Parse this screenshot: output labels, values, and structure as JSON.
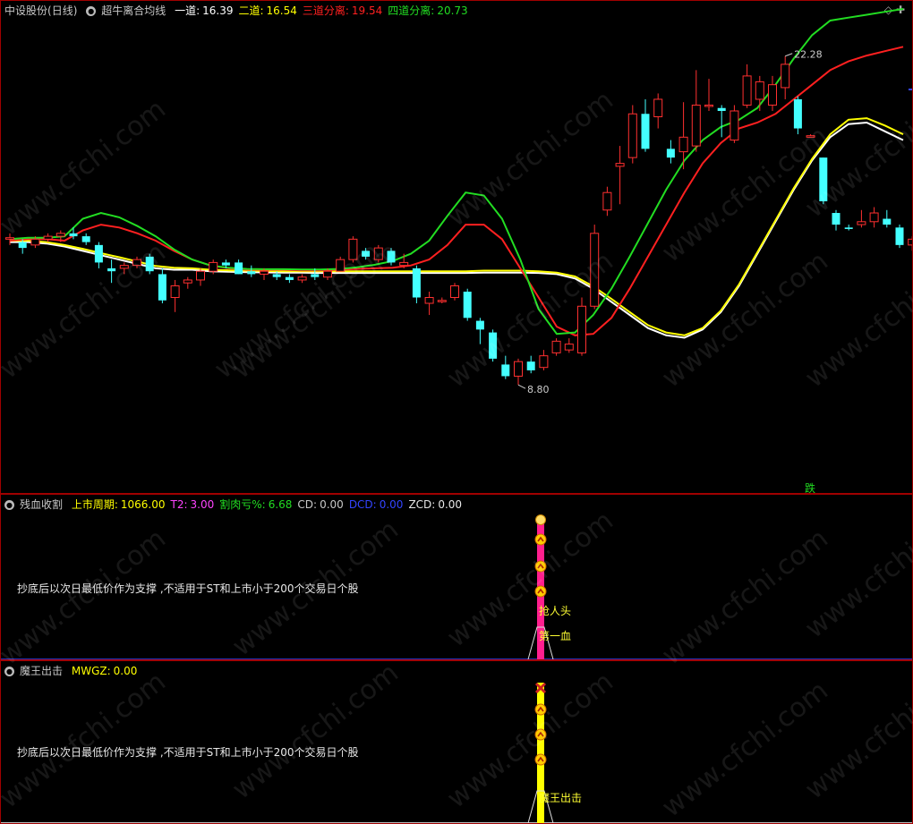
{
  "main": {
    "stock_name": "中设股份",
    "period": "(日线)",
    "indicator_name": "超牛离合均线",
    "lines": [
      {
        "label": "一道:",
        "value": "16.39",
        "color": "#ffffff"
      },
      {
        "label": "二道:",
        "value": "16.54",
        "color": "#ffff00"
      },
      {
        "label": "三道分离:",
        "value": "19.54",
        "color": "#ff2020"
      },
      {
        "label": "四道分离:",
        "value": "20.73",
        "color": "#22dd22"
      }
    ],
    "high_label": "22.28",
    "low_label": "8.80",
    "bottom_tag": "跌",
    "price_range": [
      7.6,
      23.5
    ]
  },
  "indicator1": {
    "name": "残血收割",
    "params": [
      {
        "label": "上市周期:",
        "value": "1066.00",
        "color": "#ffff00"
      },
      {
        "label": "T2:",
        "value": "3.00",
        "color": "#ff44ff"
      },
      {
        "label": "割肉亏%:",
        "value": "6.68",
        "color": "#22dd22"
      },
      {
        "label": "CD:",
        "value": "0.00",
        "color": "#c8c8c8"
      },
      {
        "label": "DCD:",
        "value": "0.00",
        "color": "#3344ff"
      },
      {
        "label": "ZCD:",
        "value": "0.00",
        "color": "#e8e8e8"
      }
    ],
    "note": "抄底后以次日最低价作为支撑 ,不适用于ST和上市小于200个交易日个股",
    "signal_label_1": "抢人头",
    "signal_label_2": "第一血"
  },
  "indicator2": {
    "name": "魔王出击",
    "params": [
      {
        "label": "MWGZ:",
        "value": "0.00",
        "color": "#ffff00"
      }
    ],
    "note": "抄底后以次日最低价作为支撑 ,不适用于ST和上市小于200个交易日个股",
    "signal_label": "魔王出击"
  },
  "watermark": "www.cfchi.com",
  "chart_data": {
    "type": "candlestick",
    "candles_ohlc": [
      [
        16.0,
        16.2,
        15.8,
        16.05
      ],
      [
        15.9,
        16.0,
        15.5,
        15.7
      ],
      [
        15.8,
        16.1,
        15.7,
        16.0
      ],
      [
        16.0,
        16.2,
        15.9,
        16.1
      ],
      [
        16.1,
        16.3,
        15.9,
        16.2
      ],
      [
        16.2,
        16.4,
        16.0,
        16.1
      ],
      [
        16.1,
        16.2,
        15.8,
        15.9
      ],
      [
        15.8,
        15.9,
        15.0,
        15.2
      ],
      [
        15.0,
        15.3,
        14.5,
        14.9
      ],
      [
        15.0,
        15.2,
        14.8,
        15.1
      ],
      [
        15.1,
        15.4,
        15.0,
        15.3
      ],
      [
        15.4,
        15.5,
        14.8,
        14.9
      ],
      [
        14.8,
        15.0,
        13.8,
        13.9
      ],
      [
        14.0,
        14.6,
        13.5,
        14.4
      ],
      [
        14.5,
        14.7,
        14.3,
        14.6
      ],
      [
        14.6,
        15.0,
        14.4,
        14.9
      ],
      [
        14.9,
        15.3,
        14.8,
        15.2
      ],
      [
        15.2,
        15.3,
        15.0,
        15.1
      ],
      [
        15.2,
        15.3,
        14.8,
        14.8
      ],
      [
        14.9,
        15.1,
        14.7,
        14.8
      ],
      [
        14.8,
        15.0,
        14.6,
        14.9
      ],
      [
        14.8,
        14.9,
        14.6,
        14.7
      ],
      [
        14.7,
        14.8,
        14.5,
        14.6
      ],
      [
        14.6,
        14.8,
        14.5,
        14.7
      ],
      [
        14.8,
        15.0,
        14.6,
        14.7
      ],
      [
        14.7,
        15.0,
        14.6,
        14.9
      ],
      [
        14.9,
        15.4,
        14.9,
        15.3
      ],
      [
        15.3,
        16.1,
        15.2,
        16.0
      ],
      [
        15.6,
        15.7,
        15.3,
        15.4
      ],
      [
        15.3,
        15.8,
        15.2,
        15.7
      ],
      [
        15.6,
        15.7,
        15.1,
        15.2
      ],
      [
        15.1,
        15.5,
        15.0,
        15.2
      ],
      [
        15.0,
        15.1,
        13.8,
        14.0
      ],
      [
        13.8,
        14.2,
        13.4,
        14.0
      ],
      [
        13.9,
        14.0,
        13.8,
        13.9
      ],
      [
        14.0,
        14.5,
        13.9,
        14.4
      ],
      [
        14.2,
        14.3,
        13.2,
        13.3
      ],
      [
        13.2,
        13.3,
        12.4,
        12.9
      ],
      [
        12.8,
        12.9,
        11.8,
        11.9
      ],
      [
        11.7,
        12.0,
        11.2,
        11.3
      ],
      [
        11.3,
        11.9,
        11.0,
        11.8
      ],
      [
        11.8,
        12.0,
        11.4,
        11.5
      ],
      [
        11.6,
        12.2,
        11.5,
        12.0
      ],
      [
        12.1,
        12.6,
        12.0,
        12.5
      ],
      [
        12.2,
        12.6,
        12.1,
        12.4
      ],
      [
        12.1,
        14.0,
        12.0,
        13.7
      ],
      [
        13.7,
        16.5,
        13.6,
        16.2
      ],
      [
        17.0,
        17.8,
        16.8,
        17.6
      ],
      [
        18.5,
        19.2,
        17.2,
        18.6
      ],
      [
        18.8,
        20.6,
        18.6,
        20.3
      ],
      [
        20.3,
        20.8,
        19.0,
        19.1
      ],
      [
        20.2,
        21.0,
        19.8,
        20.8
      ],
      [
        19.1,
        19.4,
        18.6,
        18.8
      ],
      [
        19.0,
        20.7,
        18.4,
        19.5
      ],
      [
        19.2,
        21.8,
        19.0,
        20.6
      ],
      [
        20.6,
        21.5,
        20.4,
        20.6
      ],
      [
        20.5,
        20.6,
        19.5,
        20.4
      ],
      [
        19.4,
        20.6,
        19.3,
        20.4
      ],
      [
        20.6,
        22.0,
        20.5,
        21.6
      ],
      [
        20.8,
        21.6,
        20.4,
        21.4
      ],
      [
        20.6,
        21.6,
        20.4,
        21.3
      ],
      [
        21.2,
        22.28,
        20.8,
        22.0
      ],
      [
        20.8,
        20.9,
        19.6,
        19.8
      ],
      [
        19.5,
        19.6,
        19.5,
        19.55
      ],
      [
        18.8,
        18.8,
        17.2,
        17.3
      ],
      [
        16.9,
        17.0,
        16.3,
        16.5
      ],
      [
        16.4,
        16.5,
        16.3,
        16.35
      ],
      [
        16.5,
        17.0,
        16.4,
        16.6
      ],
      [
        16.6,
        17.1,
        16.4,
        16.9
      ],
      [
        16.7,
        17.0,
        16.4,
        16.5
      ],
      [
        16.4,
        16.5,
        15.7,
        15.8
      ],
      [
        15.8,
        16.1,
        15.6,
        16.0
      ]
    ],
    "series": [
      {
        "name": "一道",
        "color": "#ffffff",
        "values": [
          15.9,
          15.9,
          15.85,
          15.75,
          15.6,
          15.45,
          15.3,
          15.15,
          15.0,
          14.95,
          14.95,
          14.9,
          14.88,
          14.87,
          14.86,
          14.85,
          14.85,
          14.84,
          14.84,
          14.84,
          14.84,
          14.84,
          14.84,
          14.84,
          14.84,
          14.84,
          14.85,
          14.85,
          14.85,
          14.84,
          14.8,
          14.65,
          14.3,
          13.85,
          13.4,
          12.95,
          12.7,
          12.62,
          12.9,
          13.5,
          14.4,
          15.5,
          16.6,
          17.7,
          18.7,
          19.5,
          19.95,
          20.0,
          19.7,
          19.4
        ]
      },
      {
        "name": "二道",
        "color": "#ffff00",
        "values": [
          15.95,
          15.95,
          15.9,
          15.8,
          15.67,
          15.52,
          15.38,
          15.23,
          15.08,
          15.02,
          15.0,
          14.95,
          14.93,
          14.92,
          14.91,
          14.9,
          14.9,
          14.9,
          14.9,
          14.9,
          14.9,
          14.9,
          14.9,
          14.9,
          14.9,
          14.9,
          14.92,
          14.92,
          14.92,
          14.9,
          14.85,
          14.72,
          14.38,
          13.95,
          13.5,
          13.05,
          12.8,
          12.7,
          12.95,
          13.55,
          14.45,
          15.55,
          16.65,
          17.75,
          18.75,
          19.6,
          20.1,
          20.15,
          19.9,
          19.6
        ]
      },
      {
        "name": "三道分离",
        "color": "#ff2020",
        "values": [
          15.95,
          16.0,
          16.0,
          15.95,
          16.3,
          16.5,
          16.4,
          16.2,
          15.95,
          15.6,
          15.3,
          15.1,
          15.0,
          14.95,
          14.95,
          14.95,
          14.93,
          14.93,
          14.95,
          14.98,
          15.0,
          15.02,
          15.1,
          15.3,
          15.8,
          16.5,
          16.5,
          16.0,
          15.0,
          14.0,
          13.0,
          12.7,
          12.75,
          13.3,
          14.3,
          15.4,
          16.5,
          17.6,
          18.6,
          19.3,
          19.8,
          20.0,
          20.3,
          20.8,
          21.3,
          21.8,
          22.1,
          22.3,
          22.45,
          22.6
        ]
      },
      {
        "name": "四道分离",
        "color": "#22dd22",
        "values": [
          16.0,
          16.05,
          16.05,
          16.1,
          16.7,
          16.9,
          16.75,
          16.45,
          16.1,
          15.65,
          15.3,
          15.1,
          15.02,
          14.98,
          14.97,
          14.97,
          14.96,
          14.96,
          14.98,
          15.03,
          15.12,
          15.25,
          15.5,
          15.95,
          16.8,
          17.6,
          17.5,
          16.7,
          15.3,
          13.6,
          12.75,
          12.8,
          13.4,
          14.3,
          15.4,
          16.55,
          17.7,
          18.7,
          19.4,
          19.85,
          20.1,
          20.5,
          21.3,
          22.2,
          23.0,
          23.5,
          23.6,
          23.7,
          23.8,
          23.9
        ]
      }
    ]
  },
  "colors": {
    "up": "#ff3030",
    "down": "#44ffff",
    "border": "#a00000",
    "ind1_bar": "#ff1f8e",
    "ind2_bar": "#ffff00"
  }
}
